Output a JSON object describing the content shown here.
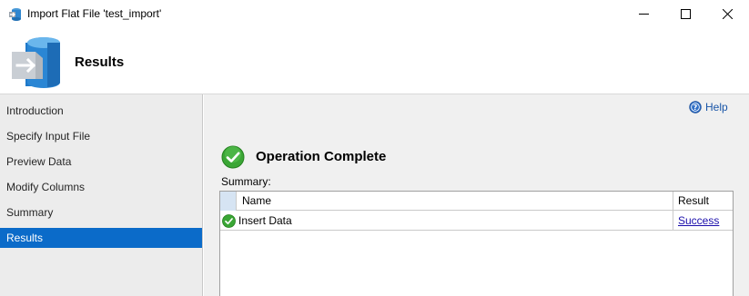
{
  "window": {
    "title": "Import Flat File 'test_import'",
    "icon": "import-flat-file-icon",
    "controls": {
      "minimize": "minimize-icon",
      "maximize": "maximize-icon",
      "close": "close-icon"
    }
  },
  "header": {
    "title": "Results",
    "icon": "database-import-icon"
  },
  "sidebar": {
    "items": [
      {
        "label": "Introduction",
        "active": false
      },
      {
        "label": "Specify Input File",
        "active": false
      },
      {
        "label": "Preview Data",
        "active": false
      },
      {
        "label": "Modify Columns",
        "active": false
      },
      {
        "label": "Summary",
        "active": false
      },
      {
        "label": "Results",
        "active": true
      }
    ]
  },
  "main": {
    "help_label": "Help",
    "help_icon": "help-icon",
    "status_title": "Operation Complete",
    "status_icon": "success-check-icon",
    "summary_label": "Summary:",
    "table": {
      "columns": [
        "Name",
        "Result"
      ],
      "rows": [
        {
          "icon": "success-check-icon",
          "name": "Insert Data",
          "result": "Success"
        }
      ]
    }
  },
  "colors": {
    "accent": "#0b6bc9",
    "success": "#3aa635",
    "link": "#1a0dab",
    "sidebar_bg": "#ececec",
    "content_bg": "#f0f0f0"
  }
}
